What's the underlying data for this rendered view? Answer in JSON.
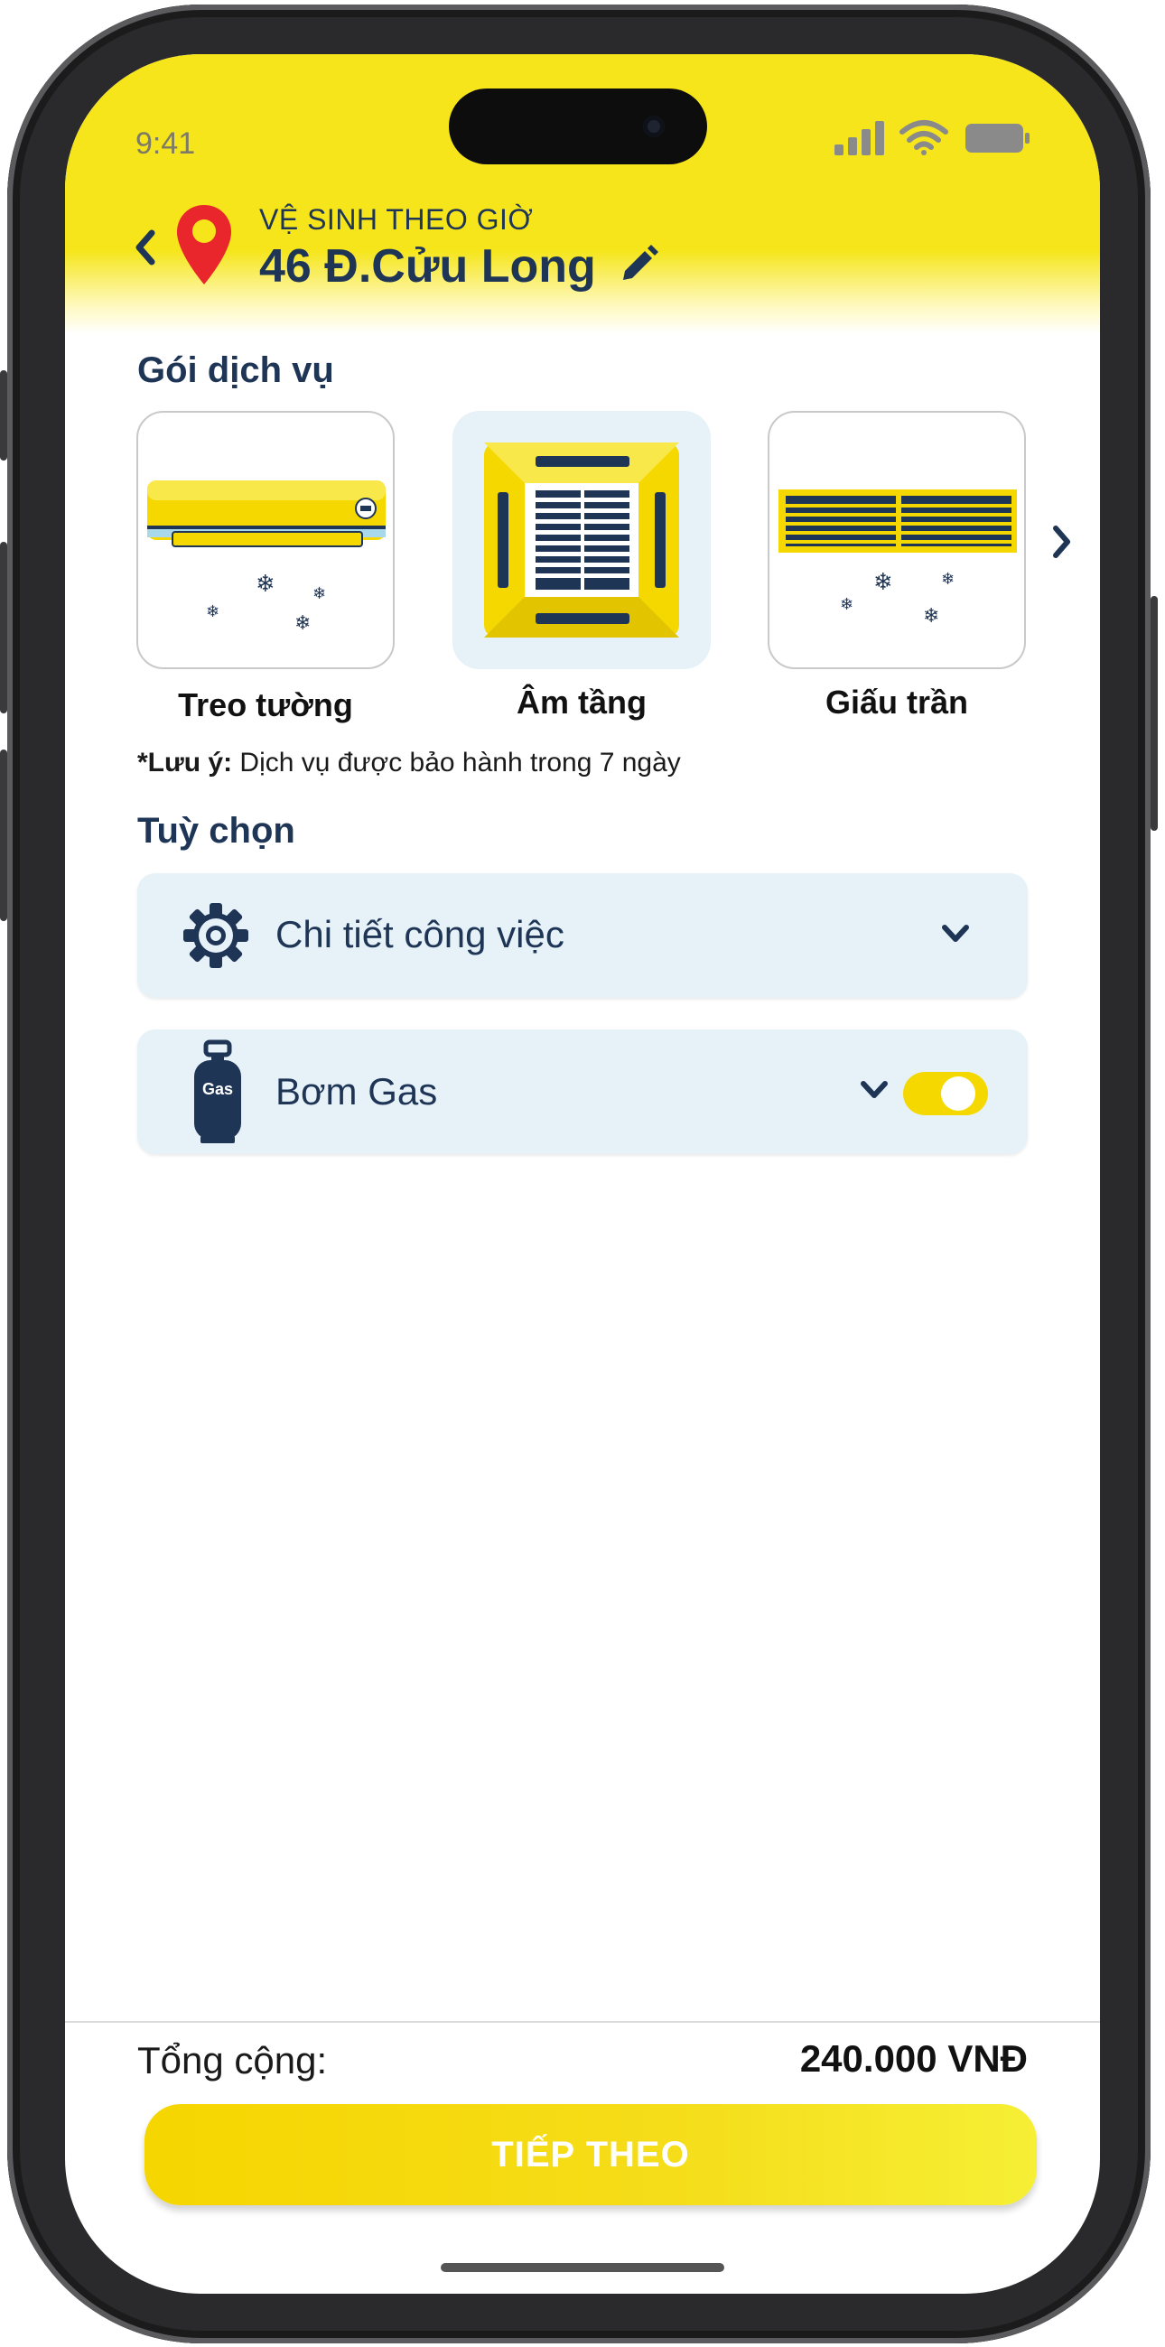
{
  "status_bar": {
    "time": "9:41"
  },
  "header": {
    "service_name": "VỆ SINH THEO GIỜ",
    "address": "46 Đ.Cửu Long"
  },
  "packages": {
    "title": "Gói dịch vụ",
    "items": [
      {
        "label": "Treo tường",
        "selected": false
      },
      {
        "label": "Âm tầng",
        "selected": true
      },
      {
        "label": "Giấu trần",
        "selected": false
      }
    ],
    "note_prefix": "*Lưu ý:",
    "note_text": " Dịch vụ được bảo hành trong 7 ngày"
  },
  "options": {
    "title": "Tuỳ chọn",
    "items": [
      {
        "label": "Chi tiết công việc",
        "icon": "gear-icon"
      },
      {
        "label": "Bơm Gas",
        "icon": "gas-cylinder-icon",
        "icon_text": "Gas",
        "toggle_on": true
      }
    ]
  },
  "footer": {
    "total_label": "Tổng cộng:",
    "total_value": "240.000 VNĐ",
    "next_label": "TIẾP THEO"
  },
  "colors": {
    "brand_yellow": "#f5e51a",
    "navy": "#1f3556",
    "pin_red": "#e8262b",
    "panel_bg": "#e6f2f8"
  }
}
